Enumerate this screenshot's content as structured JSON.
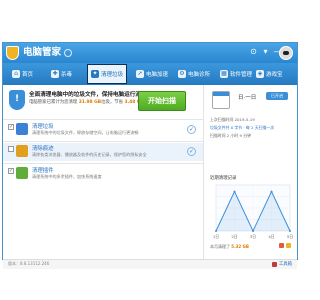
{
  "app": {
    "title": "电脑管家"
  },
  "window_controls": [
    "⊙",
    "▾",
    "—",
    "✕"
  ],
  "nav": {
    "items": [
      {
        "icon": "⌂",
        "label": "首页"
      },
      {
        "icon": "✚",
        "label": "杀毒"
      },
      {
        "icon": "✦",
        "label": "清理垃圾"
      },
      {
        "icon": "➚",
        "label": "电脑加速"
      },
      {
        "icon": "⚙",
        "label": "电脑诊所"
      },
      {
        "icon": "▦",
        "label": "软件管理"
      },
      {
        "icon": "◈",
        "label": "游戏宝"
      }
    ]
  },
  "banner": {
    "title": "全面清理电脑中的垃圾文件，保持电脑运行流畅",
    "subtitle_prefix": "电脑管家已累计为您清理",
    "subtitle_value1": "31.98 GB",
    "subtitle_mid": "垃圾，节省",
    "subtitle_value2": "3.48 GB",
    "scan_button": "开始扫描"
  },
  "rows": [
    {
      "checked": true,
      "title": "清理垃圾",
      "desc": "清理系统中的垃圾文件，释放存储空间，让电脑运行更流畅",
      "color": "#3b82d6"
    },
    {
      "checked": false,
      "title": "清除痕迹",
      "desc": "清除各类浏览器、播放器及软件的历史记录，保护您的隐私安全",
      "color": "#e0a01e"
    },
    {
      "checked": true,
      "title": "清理插件",
      "desc": "清理系统中的多余插件，加快系统速度",
      "color": "#5fae3b"
    }
  ],
  "right_panel": {
    "week_label": "日·一日",
    "week_toggle": "已开启",
    "line1": "上次扫描时间 2019-5-19",
    "line2": "垃圾文件共 0 字节 · 每 2 天扫描一次",
    "line3": "扫描时间 2 小时 9 分钟",
    "chart_title": "近期清理记录",
    "summary_prefix": "本月清理了",
    "summary_value": "5.32 GB"
  },
  "footer": {
    "version": "版本：8.8.13112.246",
    "tools": "工具箱"
  },
  "chart_data": {
    "type": "line",
    "title": "近期清理记录",
    "x": [
      "1日",
      "2日",
      "3日",
      "4日",
      "5日"
    ],
    "series": [
      {
        "values": [
          0,
          6,
          0,
          6,
          0
        ]
      }
    ],
    "ylim": [
      0,
      7
    ],
    "yticks": [
      "",
      "",
      "",
      "",
      ""
    ],
    "xlabel": "",
    "ylabel": "",
    "grid": true
  }
}
